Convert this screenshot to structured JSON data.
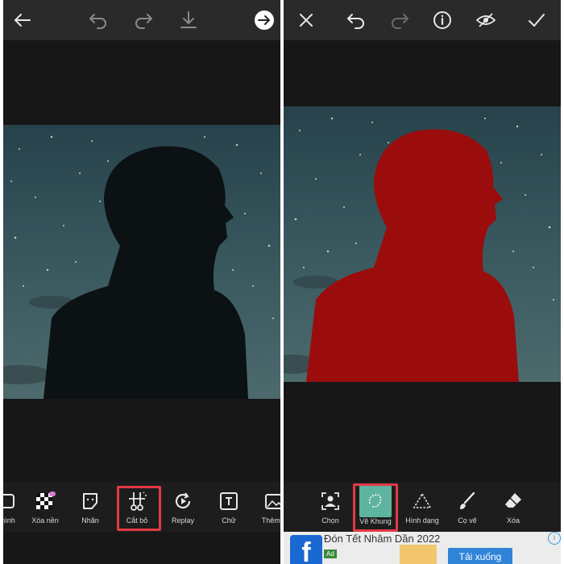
{
  "colors": {
    "toolbar_bg": "#2a2a2a",
    "canvas_bg": "#171717",
    "highlight_border": "#e53945",
    "selected_tool_fill": "#5fb4a0",
    "mask_red": "#9b0c0c",
    "ad_button": "#2f84d8"
  },
  "left_screen": {
    "top_icons": [
      "back-arrow-icon",
      "undo-icon",
      "redo-icon",
      "download-icon",
      "next-arrow-icon"
    ],
    "tools": [
      {
        "label": "hình",
        "icon": "crop-icon"
      },
      {
        "label": "Xóa nền",
        "icon": "checker-icon"
      },
      {
        "label": "Nhãn",
        "icon": "sticker-icon"
      },
      {
        "label": "Cắt bỏ",
        "icon": "scissors-icon"
      },
      {
        "label": "Replay",
        "icon": "replay-icon"
      },
      {
        "label": "Chữ",
        "icon": "text-icon"
      },
      {
        "label": "Thêm ả",
        "icon": "add-photo-icon"
      }
    ]
  },
  "right_screen": {
    "top_icons": [
      "close-icon",
      "undo-icon",
      "redo-icon",
      "info-icon",
      "hide-icon",
      "check-icon"
    ],
    "tools": [
      {
        "label": "Chọn",
        "icon": "person-select-icon"
      },
      {
        "label": "Vẽ Khung",
        "icon": "lasso-icon"
      },
      {
        "label": "Hình dạng",
        "icon": "triangle-icon"
      },
      {
        "label": "Cọ vẽ",
        "icon": "brush-icon"
      },
      {
        "label": "Xóa",
        "icon": "eraser-icon"
      }
    ]
  },
  "ad": {
    "logo_letter": "f",
    "badge": "Ad",
    "title": "Đón Tết Nhâm Dần 2022",
    "button": "Tải xuống",
    "info": "i"
  }
}
